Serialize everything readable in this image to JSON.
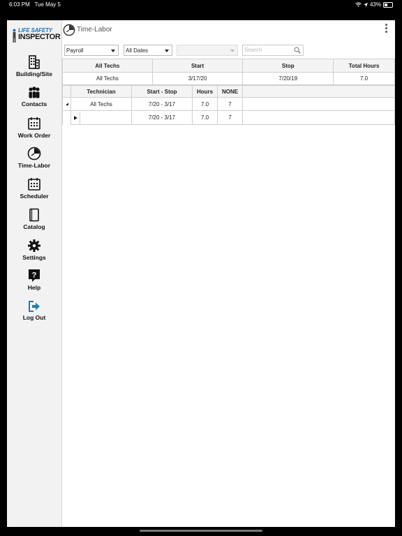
{
  "status": {
    "time": "6:03 PM",
    "date": "Tue May 5",
    "battery": "43%"
  },
  "logo": {
    "line1": "LIFE SAFETY",
    "line2": "INSPECTOR"
  },
  "sidebar": {
    "items": [
      {
        "label": "Building/Site",
        "icon": "building-icon"
      },
      {
        "label": "Contacts",
        "icon": "people-icon"
      },
      {
        "label": "Work Order",
        "icon": "calendar-icon"
      },
      {
        "label": "Time-Labor",
        "icon": "clock-icon"
      },
      {
        "label": "Scheduler",
        "icon": "calendar-icon"
      },
      {
        "label": "Catalog",
        "icon": "book-icon"
      },
      {
        "label": "Settings",
        "icon": "gear-icon"
      },
      {
        "label": "Help",
        "icon": "help-icon"
      },
      {
        "label": "Log Out",
        "icon": "logout-icon"
      }
    ]
  },
  "header": {
    "title": "Time-Labor"
  },
  "filters": {
    "report": "Payroll",
    "dates": "All Dates",
    "third": "",
    "search_placeholder": "Search"
  },
  "summary": {
    "headers": [
      "All Techs",
      "Start",
      "Stop",
      "Total Hours"
    ],
    "row": [
      "All Techs",
      "3/17/20",
      "7/20/19",
      "7.0"
    ]
  },
  "detail": {
    "headers": [
      "Technician",
      "Start - Stop",
      "Hours",
      "NONE"
    ],
    "rows": [
      {
        "tech": "All Techs",
        "range": "7/20 - 3/17",
        "hours": "7.0",
        "none": "7"
      }
    ],
    "subrows": [
      {
        "tech": "",
        "range": "7/20 - 3/17",
        "hours": "7.0",
        "none": "7"
      }
    ]
  },
  "colors": {
    "accent": "#1e6fb5",
    "logout": "#1a7fbf"
  }
}
